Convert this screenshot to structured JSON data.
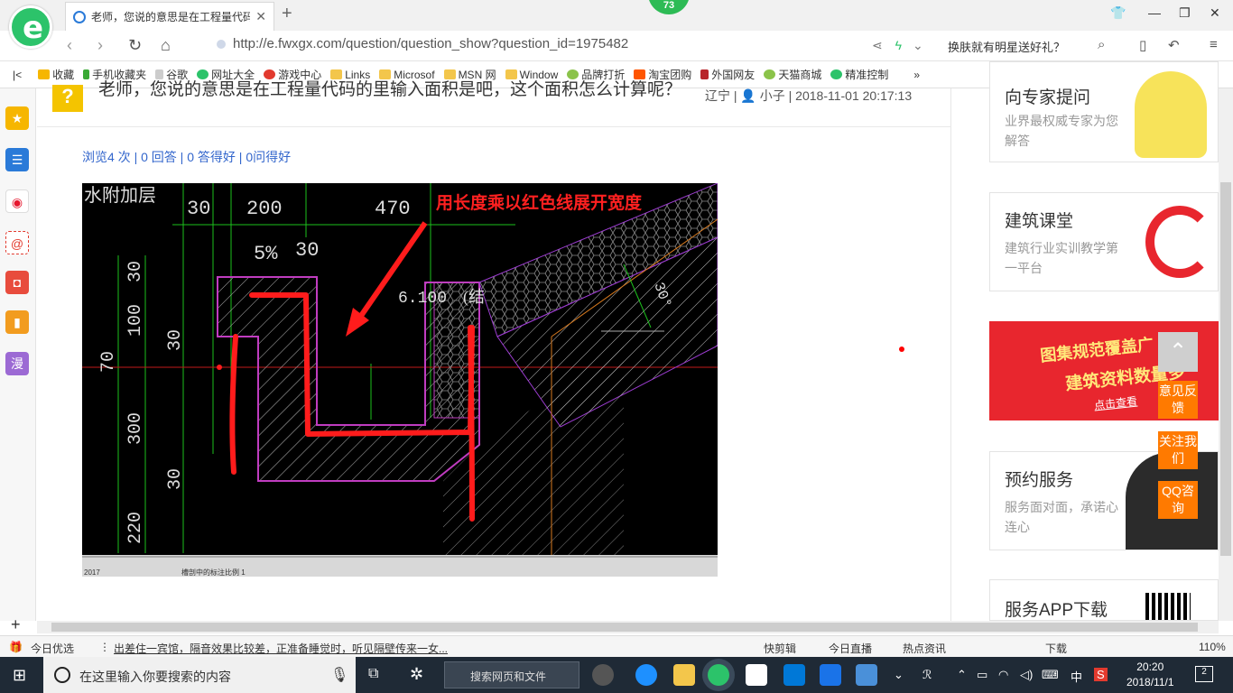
{
  "browser": {
    "tab_title": "老师，您说的意思是在工程量代码...",
    "tab_badge": "73",
    "url": "http://e.fwxgx.com/question/question_show?question_id=1975482",
    "search_hint": "换肤就有明星送好礼？"
  },
  "bookmarks": [
    {
      "label": "收藏",
      "icon": "star-icon"
    },
    {
      "label": "手机收藏夹",
      "icon": "phone-icon"
    },
    {
      "label": "谷歌",
      "icon": "page-icon"
    },
    {
      "label": "网址大全",
      "icon": "globe-icon"
    },
    {
      "label": "游戏中心",
      "icon": "game-icon"
    },
    {
      "label": "Links",
      "icon": "folder-icon"
    },
    {
      "label": "Microsof",
      "icon": "folder-icon"
    },
    {
      "label": "MSN 网",
      "icon": "folder-icon"
    },
    {
      "label": "Window",
      "icon": "folder-icon"
    },
    {
      "label": "品牌打折",
      "icon": "leaf-icon"
    },
    {
      "label": "淘宝团购",
      "icon": "taobao-icon"
    },
    {
      "label": "外国网友",
      "icon": "flag-icon"
    },
    {
      "label": "天猫商城",
      "icon": "leaf-icon"
    },
    {
      "label": "精准控制",
      "icon": "chat-icon"
    }
  ],
  "question": {
    "title": "老师，您说的意思是在工程量代码的里输入面积是吧，这个面积怎么计算呢？",
    "region": "辽宁",
    "author": "小子",
    "datetime": "2018-11-01 20:17:13",
    "stats": {
      "views": "浏览4 次",
      "answers": "0 回答",
      "good_answers": "0 答得好",
      "good_questions": "0问得好"
    }
  },
  "drawing": {
    "annotation": "用长度乘以红色线展开宽度",
    "header_label": "水附加层",
    "dims_top": [
      "30",
      "200",
      "470"
    ],
    "slope": "5%",
    "dim_30_mid": "30",
    "elevation": "6.100",
    "elevation_suffix": "(结",
    "angle": "30°",
    "left_dims": [
      "30",
      "100",
      "30",
      "70",
      "300",
      "30",
      "220"
    ],
    "footer": [
      "2017",
      "槽剖中的标注比例 1"
    ]
  },
  "sidebar_right": {
    "expert": {
      "title": "向专家提问",
      "desc": "业界最权威专家为您解答"
    },
    "classroom": {
      "title": "建筑课堂",
      "desc": "建筑行业实训教学第一平台"
    },
    "promo": {
      "line1": "图集规范覆盖广",
      "line2": "建筑资料数量多",
      "cta": "点击查看"
    },
    "booking": {
      "title": "预约服务",
      "desc": "服务面对面，承诺心连心"
    },
    "app": {
      "title": "服务APP下载"
    },
    "float_buttons": [
      "意见反馈",
      "关注我们",
      "QQ咨询"
    ]
  },
  "statusbar": {
    "left": "今日优选",
    "news": "出差住一宾馆，隔音效果比较差，正准备睡觉时，听见隔壁传来一女...",
    "items": [
      "快剪辑",
      "今日直播",
      "热点资讯",
      "下载"
    ],
    "zoom": "110%"
  },
  "taskbar": {
    "search_placeholder": "在这里输入你要搜索的内容",
    "web_search": "搜索网页和文件",
    "ime": "中",
    "time": "20:20",
    "date": "2018/11/1",
    "notifications": "2"
  },
  "colors": {
    "accent": "#2cc36a",
    "link": "#3366cc",
    "brand_orange": "#ff7a00",
    "promo_red": "#e8262e"
  }
}
